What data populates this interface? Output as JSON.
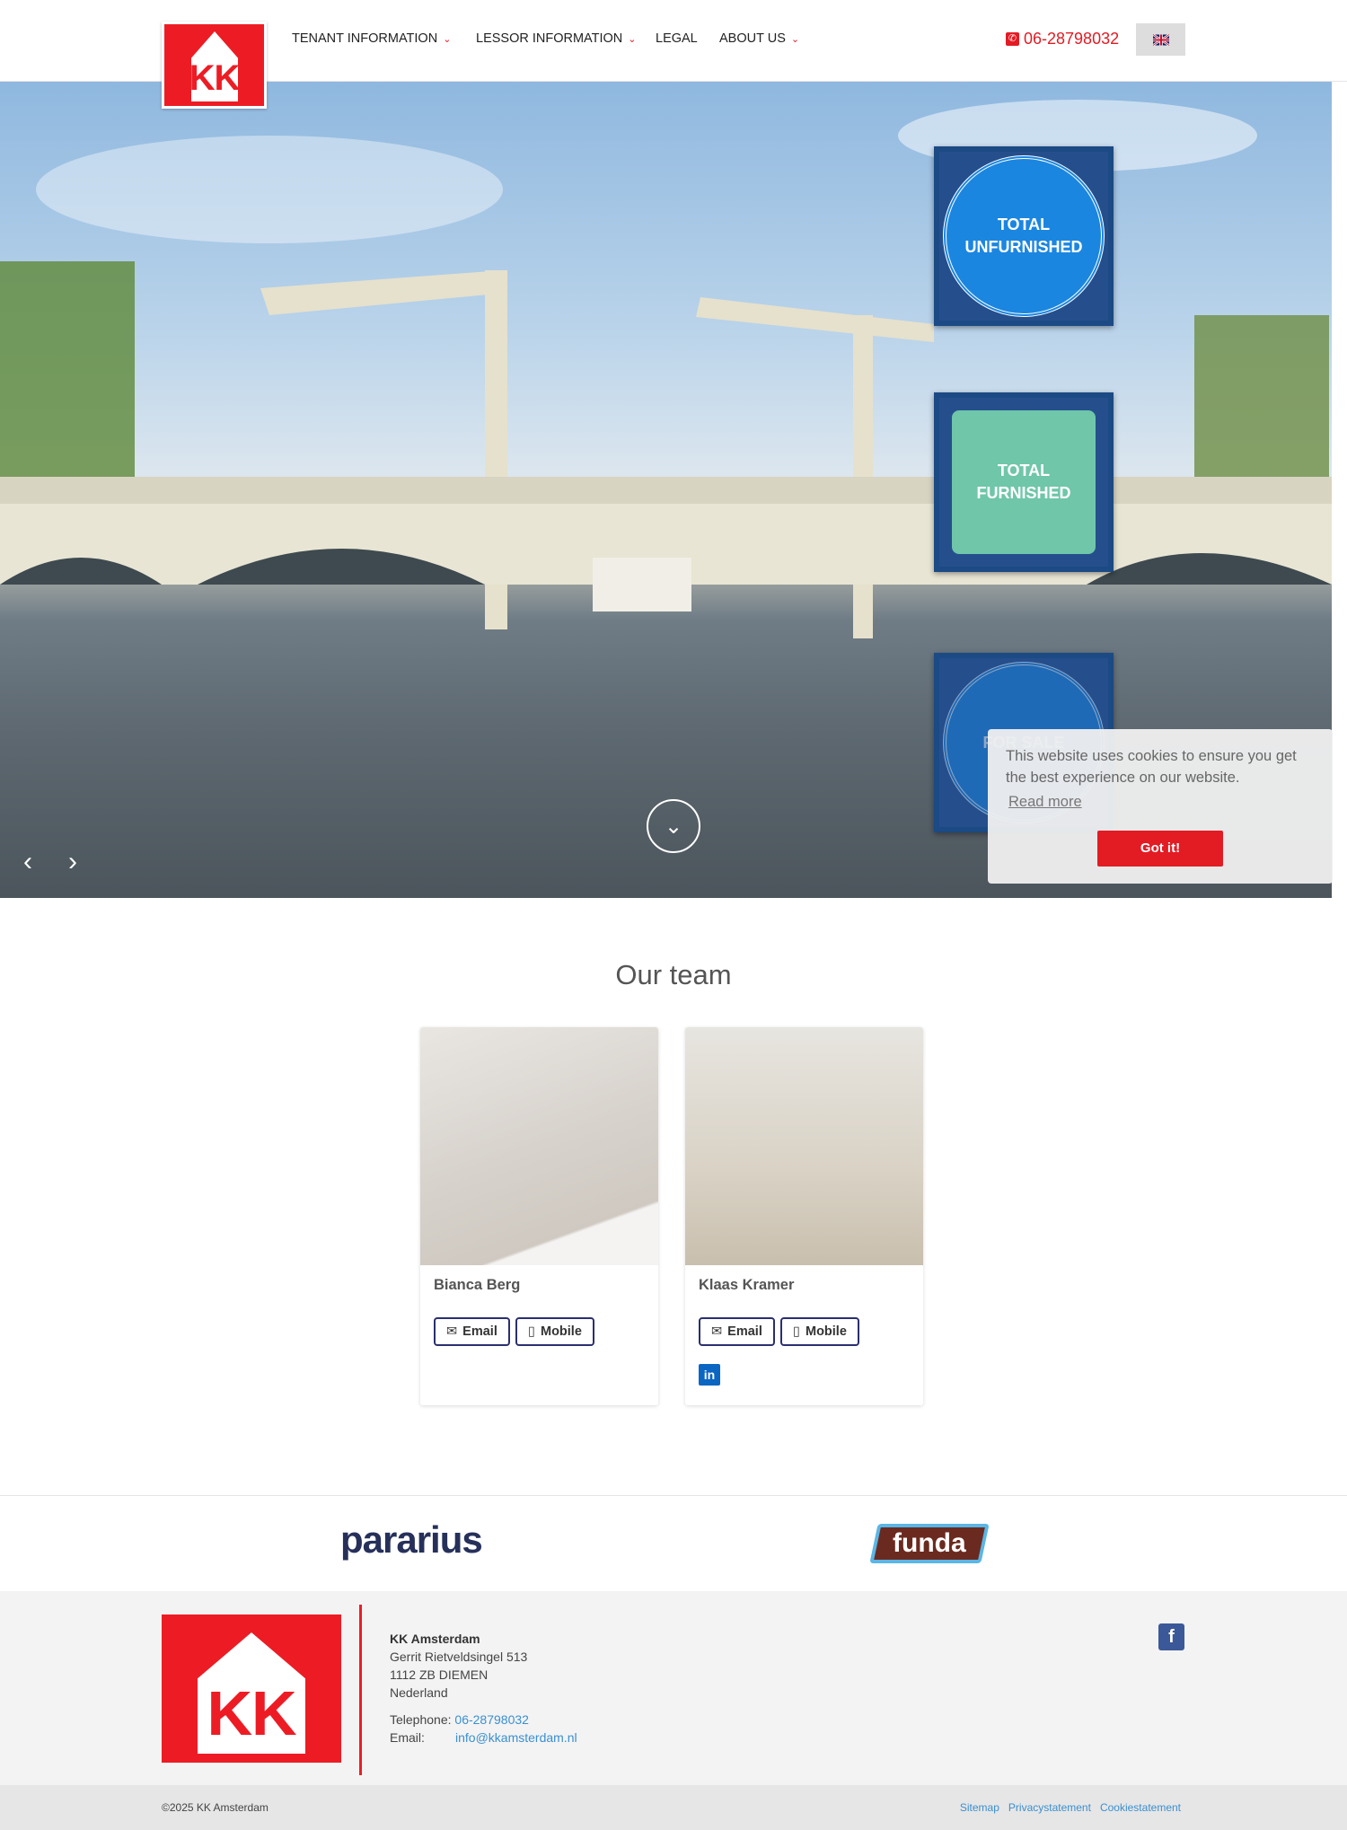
{
  "header": {
    "logo_text": "KK",
    "nav": [
      {
        "label": "TENANT INFORMATION",
        "dropdown": true
      },
      {
        "label": "LESSOR INFORMATION",
        "dropdown": true
      },
      {
        "label": "LEGAL",
        "dropdown": false
      },
      {
        "label": "ABOUT US",
        "dropdown": true
      }
    ],
    "phone": "06-28798032",
    "language": "en-flag-icon"
  },
  "hero": {
    "tiles": [
      "TOTAL UNFURNISHED",
      "TOTAL FURNISHED",
      "FOR SALE"
    ],
    "slide_count": 8,
    "active_slide": 1
  },
  "cookie": {
    "message": "This website uses cookies to ensure you get the best experience on our website.",
    "read_more": "Read more",
    "accept": "Got it!"
  },
  "team": {
    "title": "Our team",
    "members": [
      {
        "name": "Bianca Berg",
        "email_label": "Email",
        "mobile_label": "Mobile",
        "linkedin": false
      },
      {
        "name": "Klaas Kramer",
        "email_label": "Email",
        "mobile_label": "Mobile",
        "linkedin": true
      }
    ]
  },
  "partners": [
    "pararius",
    "funda"
  ],
  "footer": {
    "company": "KK Amsterdam",
    "address": [
      "Gerrit Rietveldsingel 513",
      "1112 ZB DIEMEN",
      "Nederland"
    ],
    "telephone_label": "Telephone:",
    "telephone": "06-28798032",
    "email_label": "Email:",
    "email": "info@kkamsterdam.nl",
    "copyright": "©2025 KK Amsterdam",
    "links": [
      "Sitemap",
      "Privacystatement",
      "Cookiestatement"
    ]
  },
  "colors": {
    "brand_red": "#ed1c24",
    "navy": "#2a2f6e",
    "link": "#3a8fd0"
  }
}
